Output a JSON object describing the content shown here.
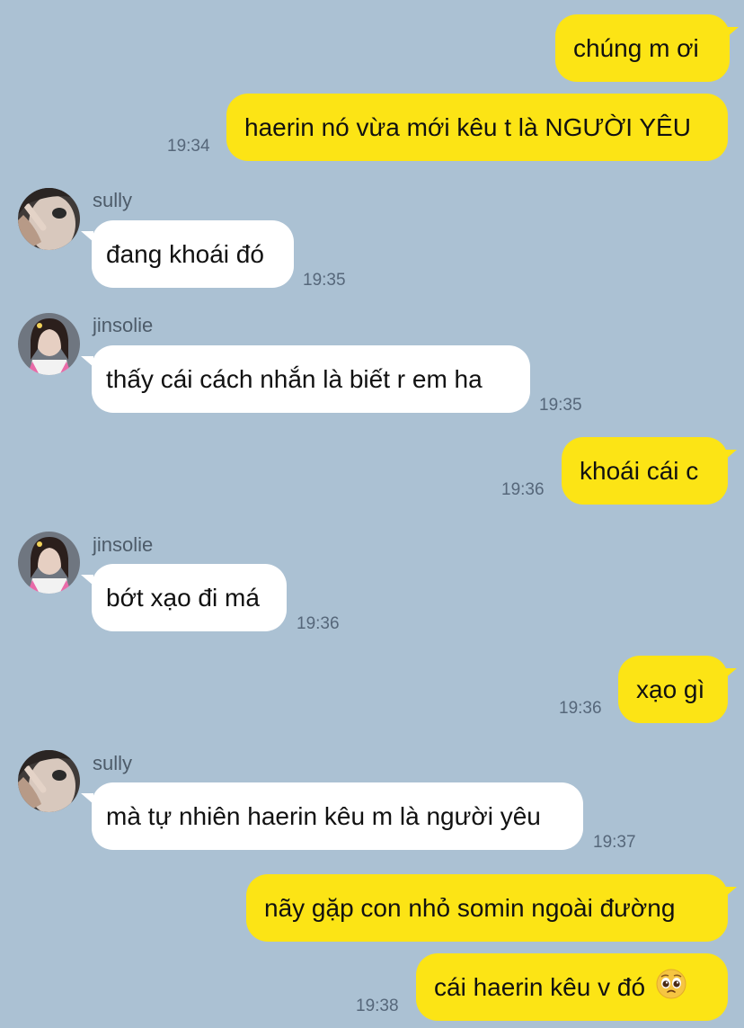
{
  "messages": [
    {
      "side": "me",
      "text": "chúng m ơi"
    },
    {
      "side": "me",
      "text": "haerin nó vừa mới kêu t là NGƯỜI YÊU",
      "time": "19:34"
    },
    {
      "side": "them",
      "sender": "sully",
      "text": "đang khoái đó",
      "time": "19:35"
    },
    {
      "side": "them",
      "sender": "jinsolie",
      "text": "thấy cái cách nhắn là biết r em ha",
      "time": "19:35"
    },
    {
      "side": "me",
      "text": "khoái cái c",
      "time": "19:36"
    },
    {
      "side": "them",
      "sender": "jinsolie",
      "text": "bớt xạo đi má",
      "time": "19:36"
    },
    {
      "side": "me",
      "text": "xạo gì",
      "time": "19:36"
    },
    {
      "side": "them",
      "sender": "sully",
      "text": "mà tự nhiên haerin kêu m là người yêu",
      "time": "19:37"
    },
    {
      "side": "me",
      "text": "nãy gặp con nhỏ somin ngoài đường"
    },
    {
      "side": "me",
      "text": "cái haerin kêu v đó",
      "time": "19:38",
      "emoji": "pleading-face-icon"
    }
  ],
  "colors": {
    "background": "#abc1d3",
    "my_bubble": "#fce415",
    "their_bubble": "#ffffff"
  }
}
